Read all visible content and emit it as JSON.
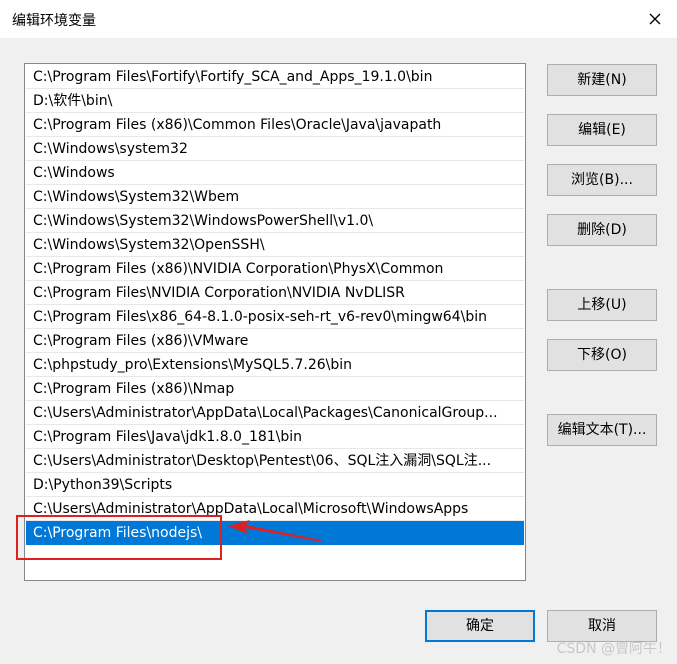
{
  "window": {
    "title": "编辑环境变量"
  },
  "path_list": {
    "items": [
      "C:\\Program Files\\Fortify\\Fortify_SCA_and_Apps_19.1.0\\bin",
      "D:\\软件\\bin\\",
      "C:\\Program Files (x86)\\Common Files\\Oracle\\Java\\javapath",
      "C:\\Windows\\system32",
      "C:\\Windows",
      "C:\\Windows\\System32\\Wbem",
      "C:\\Windows\\System32\\WindowsPowerShell\\v1.0\\",
      "C:\\Windows\\System32\\OpenSSH\\",
      "C:\\Program Files (x86)\\NVIDIA Corporation\\PhysX\\Common",
      "C:\\Program Files\\NVIDIA Corporation\\NVIDIA NvDLISR",
      "C:\\Program Files\\x86_64-8.1.0-posix-seh-rt_v6-rev0\\mingw64\\bin",
      "C:\\Program Files (x86)\\VMware",
      "C:\\phpstudy_pro\\Extensions\\MySQL5.7.26\\bin",
      "C:\\Program Files (x86)\\Nmap",
      "C:\\Users\\Administrator\\AppData\\Local\\Packages\\CanonicalGroup...",
      "C:\\Program Files\\Java\\jdk1.8.0_181\\bin",
      "C:\\Users\\Administrator\\Desktop\\Pentest\\06、SQL注入漏洞\\SQL注...",
      "D:\\Python39\\Scripts",
      "C:\\Users\\Administrator\\AppData\\Local\\Microsoft\\WindowsApps",
      "C:\\Program Files\\nodejs\\"
    ],
    "selected_index": 19
  },
  "buttons": {
    "new": "新建(N)",
    "edit": "编辑(E)",
    "browse": "浏览(B)...",
    "delete": "删除(D)",
    "move_up": "上移(U)",
    "move_down": "下移(O)",
    "edit_text": "编辑文本(T)...",
    "ok": "确定",
    "cancel": "取消"
  },
  "watermark": "CSDN @曾阿牛！",
  "colors": {
    "selection": "#0078d7",
    "annotation": "#e02020"
  }
}
